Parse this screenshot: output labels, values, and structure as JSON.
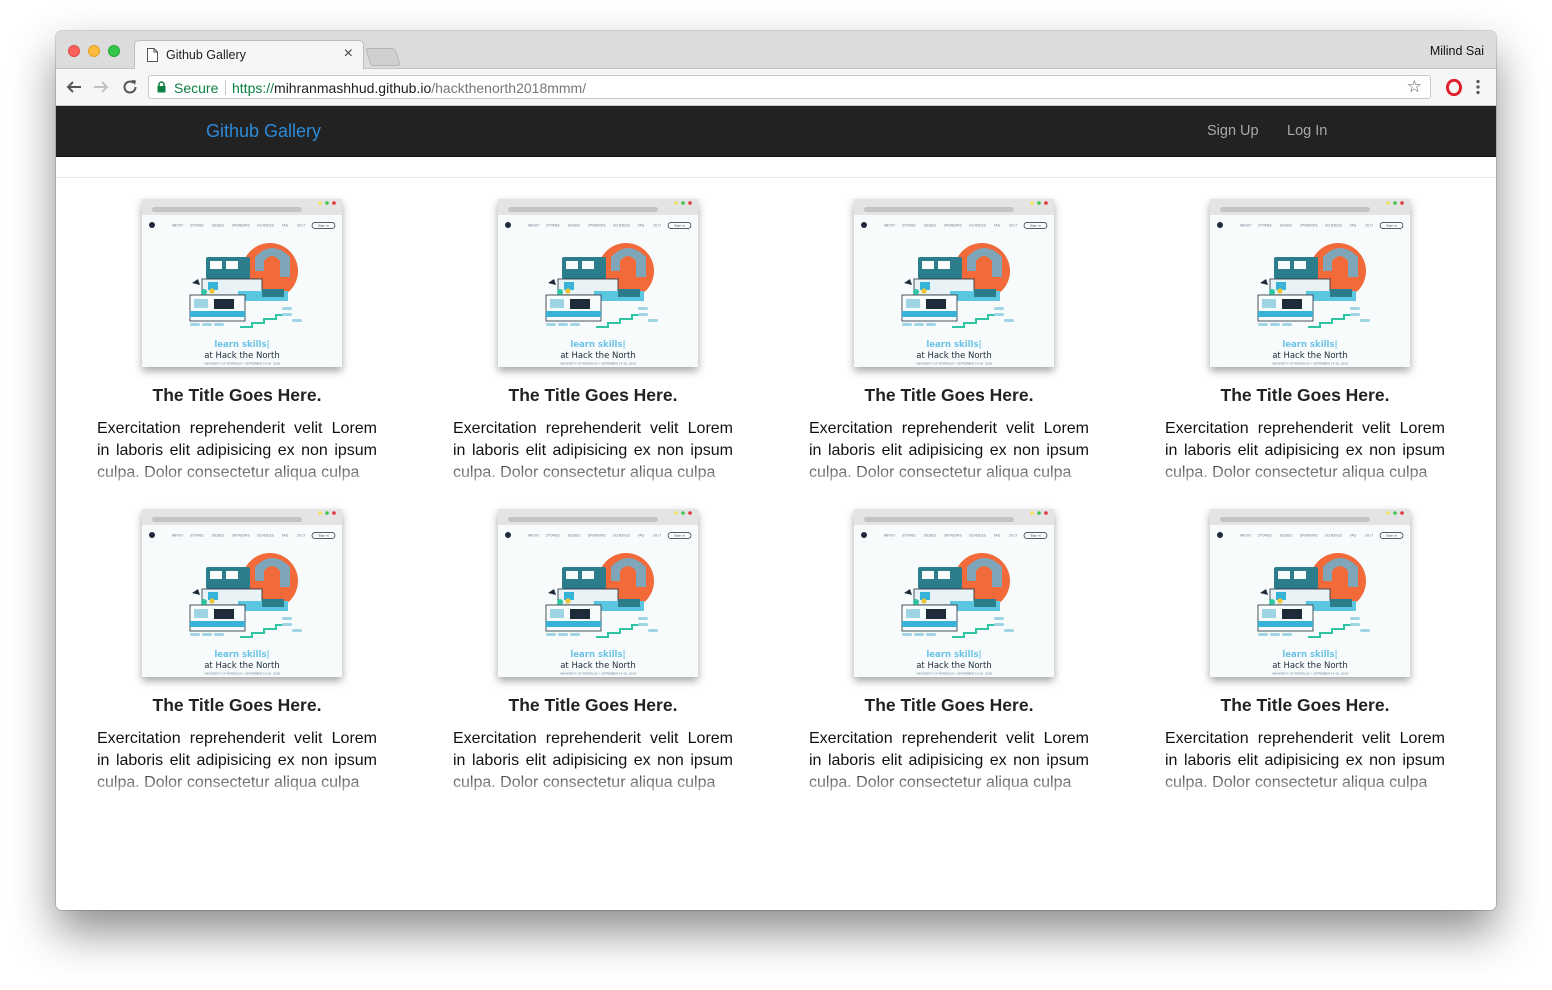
{
  "browser": {
    "tab_title": "Github Gallery",
    "profile_name": "Milind Sai",
    "secure_label": "Secure",
    "url_scheme": "https://",
    "url_host": "mihranmashhud.github.io",
    "url_path": "/hackthenorth2018mmm/"
  },
  "site": {
    "brand": "Github Gallery",
    "nav": [
      "Sign Up",
      "Log In"
    ]
  },
  "thumbnail": {
    "nav_items": [
      "ABOUT",
      "STORIES",
      "JUDGES",
      "SPONSORS",
      "SCHEDULE",
      "FAQ",
      "2017"
    ],
    "sign_in": "Sign in",
    "headline": "learn skills|",
    "subhead": "at Hack the North",
    "footer": "UNIVERSITY OF WATERLOO • SEPTEMBER 14-16, 2018"
  },
  "cards": [
    {
      "title": "The Title Goes Here.",
      "description": "Exercitation reprehenderit velit Lorem in laboris elit adipisicing ex non ipsum culpa. Dolor consectetur aliqua culpa"
    },
    {
      "title": "The Title Goes Here.",
      "description": "Exercitation reprehenderit velit Lorem in laboris elit adipisicing ex non ipsum culpa. Dolor consectetur aliqua culpa"
    },
    {
      "title": "The Title Goes Here.",
      "description": "Exercitation reprehenderit velit Lorem in laboris elit adipisicing ex non ipsum culpa. Dolor consectetur aliqua culpa"
    },
    {
      "title": "The Title Goes Here.",
      "description": "Exercitation reprehenderit velit Lorem in laboris elit adipisicing ex non ipsum culpa. Dolor consectetur aliqua culpa"
    },
    {
      "title": "The Title Goes Here.",
      "description": "Exercitation reprehenderit velit Lorem in laboris elit adipisicing ex non ipsum culpa. Dolor consectetur aliqua culpa"
    },
    {
      "title": "The Title Goes Here.",
      "description": "Exercitation reprehenderit velit Lorem in laboris elit adipisicing ex non ipsum culpa. Dolor consectetur aliqua culpa"
    },
    {
      "title": "The Title Goes Here.",
      "description": "Exercitation reprehenderit velit Lorem in laboris elit adipisicing ex non ipsum culpa. Dolor consectetur aliqua culpa"
    },
    {
      "title": "The Title Goes Here.",
      "description": "Exercitation reprehenderit velit Lorem in laboris elit adipisicing ex non ipsum culpa. Dolor consectetur aliqua culpa"
    }
  ],
  "colors": {
    "brand": "#2c8ad9",
    "navbar_bg": "#222222",
    "secure_green": "#0b8043"
  }
}
